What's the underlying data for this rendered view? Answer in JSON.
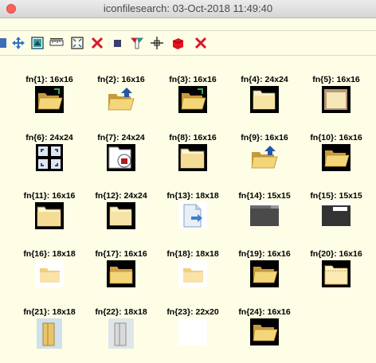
{
  "window": {
    "title": "iconfilesearch: 03-Oct-2018 11:49:40"
  },
  "toolbar": {
    "buttons": [
      {
        "name": "pan-icon"
      },
      {
        "name": "move-icon"
      },
      {
        "name": "image-icon"
      },
      {
        "name": "ruler-icon"
      },
      {
        "name": "fit-icon"
      },
      {
        "name": "close-x-icon"
      },
      {
        "name": "stop-square-icon"
      },
      {
        "name": "color-tool-icon"
      },
      {
        "name": "crosshair-icon"
      },
      {
        "name": "red-cube-icon"
      },
      {
        "name": "delete-x-icon"
      }
    ]
  },
  "icons": [
    {
      "label": "fn{1}: 16x16",
      "kind": "folder-open-green"
    },
    {
      "label": "fn{2}: 16x16",
      "kind": "folder-up"
    },
    {
      "label": "fn{3}: 16x16",
      "kind": "folder-open-green"
    },
    {
      "label": "fn{4}: 24x24",
      "kind": "folder-plain"
    },
    {
      "label": "fn{5}: 16x16",
      "kind": "folder-plain-brown"
    },
    {
      "label": "fn{6}: 24x24",
      "kind": "grid-windows"
    },
    {
      "label": "fn{7}: 24x24",
      "kind": "folder-doc-lock"
    },
    {
      "label": "fn{8}: 16x16",
      "kind": "folder-plain-dark"
    },
    {
      "label": "fn{9}: 16x16",
      "kind": "folder-up"
    },
    {
      "label": "fn{10}: 16x16",
      "kind": "folder-open"
    },
    {
      "label": "fn{11}: 16x16",
      "kind": "folder-plain-dark"
    },
    {
      "label": "fn{12}: 24x24",
      "kind": "folder-plain"
    },
    {
      "label": "fn{13}: 18x18",
      "kind": "doc-arrow"
    },
    {
      "label": "fn{14}: 15x15",
      "kind": "dark-window"
    },
    {
      "label": "fn{15}: 15x15",
      "kind": "dark-window-white"
    },
    {
      "label": "fn{16}: 18x18",
      "kind": "folder-light"
    },
    {
      "label": "fn{17}: 16x16",
      "kind": "folder-closed"
    },
    {
      "label": "fn{18}: 18x18",
      "kind": "folder-light"
    },
    {
      "label": "fn{19}: 16x16",
      "kind": "folder-open"
    },
    {
      "label": "fn{20}: 16x16",
      "kind": "folder-dotted"
    },
    {
      "label": "fn{21}: 18x18",
      "kind": "folder-vertical"
    },
    {
      "label": "fn{22}: 18x18",
      "kind": "folder-vertical-gray"
    },
    {
      "label": "fn{23}: 22x20",
      "kind": "blank"
    },
    {
      "label": "fn{24}: 16x16",
      "kind": "folder-open"
    }
  ]
}
